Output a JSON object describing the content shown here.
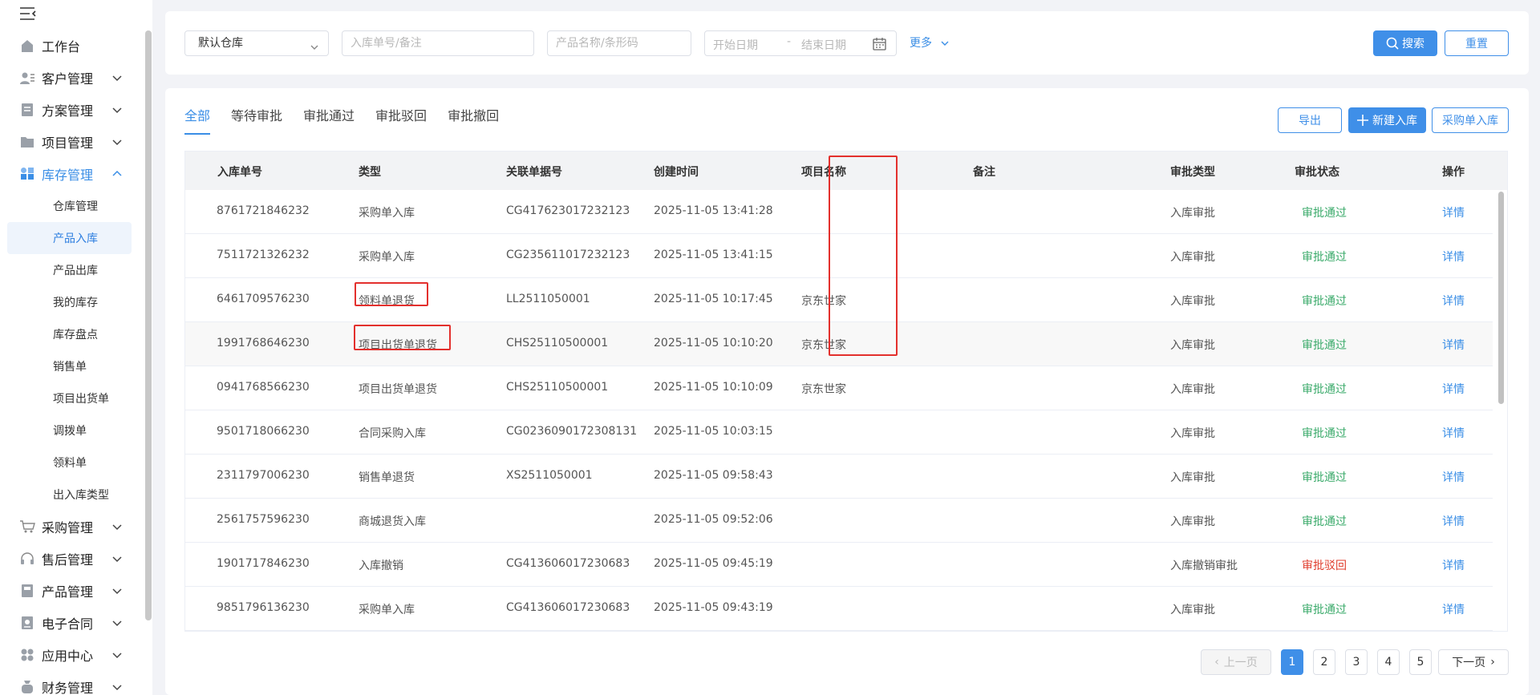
{
  "sidebar": {
    "menu": [
      {
        "label": "工作台",
        "icon": "home-icon",
        "chevron": false
      },
      {
        "label": "客户管理",
        "icon": "customer-icon",
        "chevron": true
      },
      {
        "label": "方案管理",
        "icon": "plan-icon",
        "chevron": true
      },
      {
        "label": "项目管理",
        "icon": "folder-icon",
        "chevron": true
      },
      {
        "label": "库存管理",
        "icon": "inventory-icon",
        "chevron": true,
        "open": true
      }
    ],
    "submenu": [
      "仓库管理",
      "产品入库",
      "产品出库",
      "我的库存",
      "库存盘点",
      "销售单",
      "项目出货单",
      "调拨单",
      "领料单",
      "出入库类型"
    ],
    "active_sub": "产品入库",
    "menu_bottom": [
      {
        "label": "采购管理",
        "icon": "cart-icon"
      },
      {
        "label": "售后管理",
        "icon": "headset-icon"
      },
      {
        "label": "产品管理",
        "icon": "product-icon"
      },
      {
        "label": "电子合同",
        "icon": "contract-icon"
      },
      {
        "label": "应用中心",
        "icon": "apps-icon"
      },
      {
        "label": "财务管理",
        "icon": "finance-icon"
      }
    ]
  },
  "filter": {
    "warehouse_value": "默认仓库",
    "order_placeholder": "入库单号/备注",
    "product_placeholder": "产品名称/条形码",
    "start_date_placeholder": "开始日期",
    "date_separator": "-",
    "end_date_placeholder": "结束日期",
    "more_label": "更多",
    "search_label": "搜索",
    "reset_label": "重置"
  },
  "tabs": [
    "全部",
    "等待审批",
    "审批通过",
    "审批驳回",
    "审批撤回"
  ],
  "active_tab": "全部",
  "actions": {
    "export_label": "导出",
    "new_label": "新建入库",
    "purchase_label": "采购单入库"
  },
  "table": {
    "headers": [
      "入库单号",
      "类型",
      "关联单据号",
      "创建时间",
      "项目名称",
      "备注",
      "审批类型",
      "审批状态",
      "操作"
    ],
    "rows": [
      {
        "no": "8761721846232",
        "type": "采购单入库",
        "ref": "CG417623017232123",
        "time": "2025-11-05 13:41:28",
        "project": "",
        "note": "",
        "approval_type": "入库审批",
        "status": "审批通过",
        "action": "详情"
      },
      {
        "no": "7511721326232",
        "type": "采购单入库",
        "ref": "CG235611017232123",
        "time": "2025-11-05 13:41:15",
        "project": "",
        "note": "",
        "approval_type": "入库审批",
        "status": "审批通过",
        "action": "详情"
      },
      {
        "no": "6461709576230",
        "type": "领料单退货",
        "ref": "LL2511050001",
        "time": "2025-11-05 10:17:45",
        "project": "京东世家",
        "note": "",
        "approval_type": "入库审批",
        "status": "审批通过",
        "action": "详情"
      },
      {
        "no": "1991768646230",
        "type": "项目出货单退货",
        "ref": "CHS25110500001",
        "time": "2025-11-05 10:10:20",
        "project": "京东世家",
        "note": "",
        "approval_type": "入库审批",
        "status": "审批通过",
        "action": "详情"
      },
      {
        "no": "0941768566230",
        "type": "项目出货单退货",
        "ref": "CHS25110500001",
        "time": "2025-11-05 10:10:09",
        "project": "京东世家",
        "note": "",
        "approval_type": "入库审批",
        "status": "审批通过",
        "action": "详情"
      },
      {
        "no": "9501718066230",
        "type": "合同采购入库",
        "ref": "CG0236090172308131",
        "time": "2025-11-05 10:03:15",
        "project": "",
        "note": "",
        "approval_type": "入库审批",
        "status": "审批通过",
        "action": "详情"
      },
      {
        "no": "2311797006230",
        "type": "销售单退货",
        "ref": "XS2511050001",
        "time": "2025-11-05 09:58:43",
        "project": "",
        "note": "",
        "approval_type": "入库审批",
        "status": "审批通过",
        "action": "详情"
      },
      {
        "no": "2561757596230",
        "type": "商城退货入库",
        "ref": "",
        "time": "2025-11-05 09:52:06",
        "project": "",
        "note": "",
        "approval_type": "入库审批",
        "status": "审批通过",
        "action": "详情"
      },
      {
        "no": "1901717846230",
        "type": "入库撤销",
        "ref": "CG413606017230683",
        "time": "2025-11-05 09:45:19",
        "project": "",
        "note": "",
        "approval_type": "入库撤销审批",
        "status": "审批驳回",
        "action": "详情"
      },
      {
        "no": "9851796136230",
        "type": "采购单入库",
        "ref": "CG413606017230683",
        "time": "2025-11-05 09:43:19",
        "project": "",
        "note": "",
        "approval_type": "入库审批",
        "status": "审批通过",
        "action": "详情"
      }
    ]
  },
  "pagination": {
    "prev_label": "上一页",
    "pages": [
      "1",
      "2",
      "3",
      "4",
      "5"
    ],
    "current": "1",
    "next_label": "下一页"
  },
  "colors": {
    "accent": "#3f8fe8",
    "status_ok": "#3aaa6a",
    "status_rejected": "#e03c2c",
    "highlight_box": "#e3302d"
  }
}
